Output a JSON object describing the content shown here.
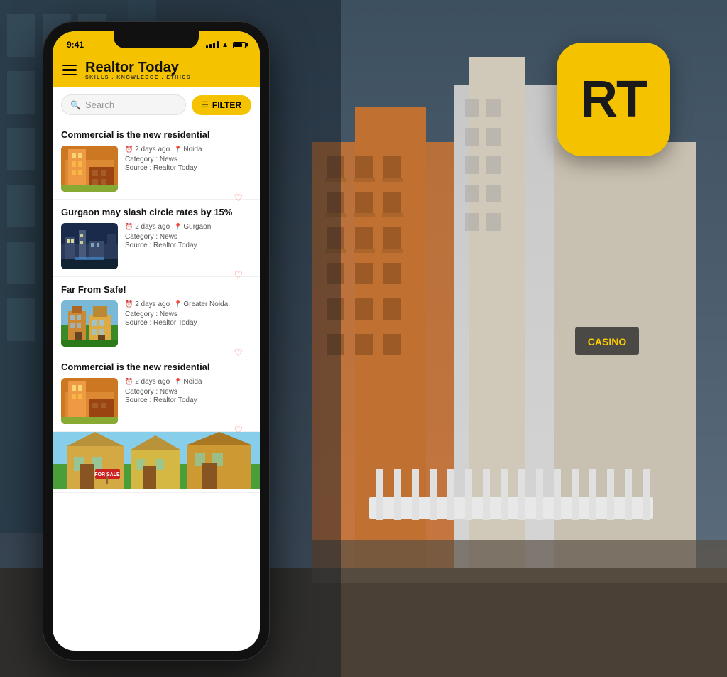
{
  "background": {
    "color": "#5a7080"
  },
  "app_icon": {
    "text": "RT",
    "bg_color": "#F5C200"
  },
  "phone": {
    "status_bar": {
      "time": "9:41",
      "signal": "signal",
      "wifi": "wifi",
      "battery": "battery"
    },
    "header": {
      "title": "Realtor Today",
      "subtitle": "SKILLS . KNOWLEDGE . ETHICS",
      "hamburger_label": "menu"
    },
    "search": {
      "placeholder": "Search",
      "filter_label": "FILTER"
    },
    "news_items": [
      {
        "title": "Commercial is the new residential",
        "time": "2 days ago",
        "location": "Noida",
        "category": "Category : News",
        "source": "Source : Realtor Today",
        "thumb_type": "building"
      },
      {
        "title": "Gurgaon may slash circle rates by 15%",
        "time": "2 days ago",
        "location": "Gurgaon",
        "category": "Category : News",
        "source": "Source : Realtor Today",
        "thumb_type": "city"
      },
      {
        "title": "Far From Safe!",
        "time": "2 days ago",
        "location": "Greater Noida",
        "category": "Category : News",
        "source": "Source : Realtor Today",
        "thumb_type": "green"
      },
      {
        "title": "Commercial is the new residential",
        "time": "2 days ago",
        "location": "Noida",
        "category": "Category : News",
        "source": "Source : Realtor Today",
        "thumb_type": "building"
      }
    ],
    "for_sale_text": "FOR SALE"
  }
}
